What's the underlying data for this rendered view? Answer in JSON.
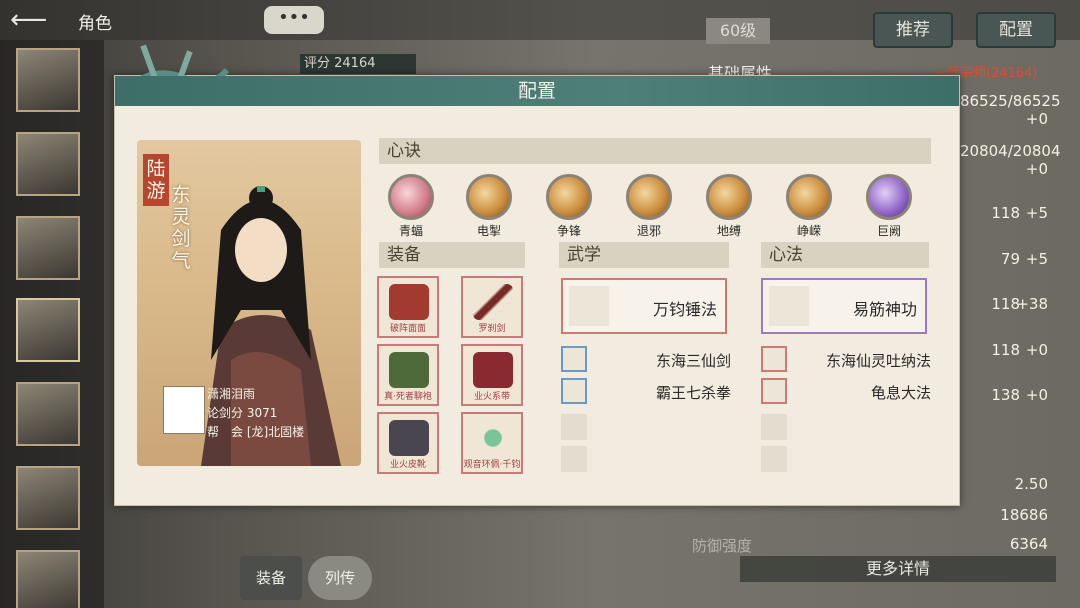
{
  "header": {
    "back_icon": "back-arrow-icon",
    "title": "角色",
    "chat_glyph": "•••",
    "level": "60级",
    "recommend_label": "推荐",
    "config_label": "配置"
  },
  "background": {
    "score_label": "评分 24164",
    "attr_title": "基础属性",
    "grandmaster": "一代宗师(24164)",
    "stats": [
      "86525/86525",
      "+0",
      "20804/20804",
      "+0",
      "118",
      "+5",
      "79",
      "+5",
      "118",
      "+38",
      "118",
      "+0",
      "138",
      "+0",
      "2.50",
      "18686",
      "6364"
    ],
    "defense_label": "防御强度",
    "more_detail": "更多详情",
    "tab_equip": "装备",
    "tab_bio": "列传"
  },
  "modal": {
    "title": "配置",
    "character": {
      "name": "陆游",
      "title": "东灵剑气",
      "player_name": "潇湘泪雨",
      "player_score": "论剑分 3071",
      "player_guild": "帮　会 [龙]北固楼"
    },
    "sections": {
      "xinjue": "心诀",
      "equip": "装备",
      "martial": "武学",
      "heart": "心法"
    },
    "skills": [
      {
        "label": "青蝠",
        "icon": "bat-swirl-icon",
        "tone": "pink"
      },
      {
        "label": "电掣",
        "icon": "boot-icon",
        "tone": "gold"
      },
      {
        "label": "争锋",
        "icon": "fist-icon",
        "tone": "gold"
      },
      {
        "label": "退邪",
        "icon": "gate-icon",
        "tone": "gold"
      },
      {
        "label": "地缚",
        "icon": "spiral-icon",
        "tone": "gold"
      },
      {
        "label": "峥嵘",
        "icon": "cloud-icon",
        "tone": "gold"
      },
      {
        "label": "巨阙",
        "icon": "sword-crest-icon",
        "tone": "purple"
      }
    ],
    "equipment": [
      {
        "name": "破阵面面",
        "icon": "mask-icon"
      },
      {
        "name": "罗刹剑",
        "icon": "sword-icon"
      },
      {
        "name": "真·死者聊袍",
        "icon": "robe-icon"
      },
      {
        "name": "业火系带",
        "icon": "belt-icon"
      },
      {
        "name": "业火皮靴",
        "icon": "boots-icon"
      },
      {
        "name": "观音环佩·千钧",
        "icon": "pendant-icon"
      }
    ],
    "martial": {
      "main": "万钧锤法",
      "items": [
        "东海三仙剑",
        "霸王七杀拳"
      ]
    },
    "heart": {
      "main": "易筋神功",
      "items": [
        "东海仙灵吐纳法",
        "龟息大法"
      ]
    }
  }
}
